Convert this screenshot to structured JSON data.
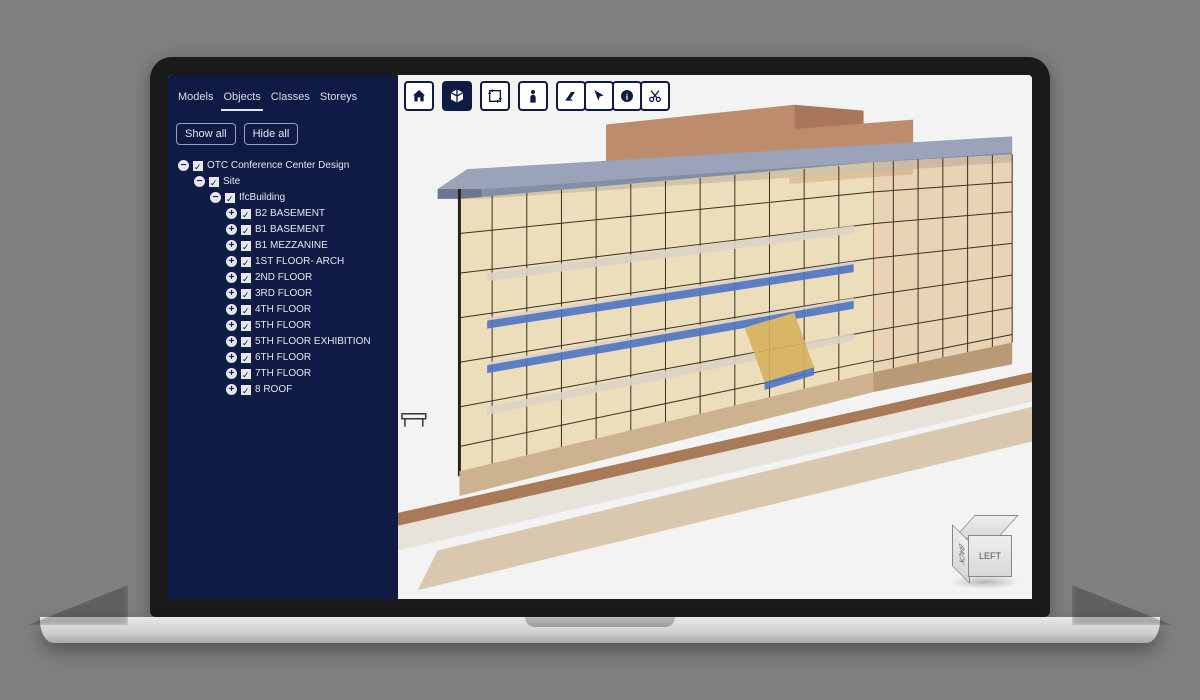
{
  "sidebar": {
    "tabs": [
      "Models",
      "Objects",
      "Classes",
      "Storeys"
    ],
    "active_tab": 1,
    "show_all": "Show all",
    "hide_all": "Hide all"
  },
  "tree": {
    "root": {
      "label": "OTC Conference Center Design",
      "expanded": true,
      "checked": true
    },
    "site": {
      "label": "Site",
      "expanded": true,
      "checked": true
    },
    "building": {
      "label": "IfcBuilding",
      "expanded": true,
      "checked": true
    },
    "storeys": [
      {
        "label": "B2 BASEMENT",
        "checked": true
      },
      {
        "label": "B1 BASEMENT",
        "checked": true
      },
      {
        "label": "B1 MEZZANINE",
        "checked": true
      },
      {
        "label": "1ST FLOOR- ARCH",
        "checked": true
      },
      {
        "label": "2ND FLOOR",
        "checked": true
      },
      {
        "label": "3RD FLOOR",
        "checked": true
      },
      {
        "label": "4TH FLOOR",
        "checked": true
      },
      {
        "label": "5TH FLOOR",
        "checked": true
      },
      {
        "label": "5TH FLOOR EXHIBITION",
        "checked": true
      },
      {
        "label": "6TH FLOOR",
        "checked": true
      },
      {
        "label": "7TH FLOOR",
        "checked": true
      },
      {
        "label": "8 ROOF",
        "checked": true
      }
    ]
  },
  "toolbar": [
    {
      "id": "home",
      "name": "home-icon",
      "active": false
    },
    {
      "id": "cube",
      "name": "cube-icon",
      "active": true
    },
    {
      "id": "crop",
      "name": "section-plane-icon",
      "active": false
    },
    {
      "id": "person",
      "name": "first-person-icon",
      "active": false
    },
    {
      "id": "eraser",
      "name": "hide-icon",
      "active": false
    },
    {
      "id": "pointer",
      "name": "select-icon",
      "active": false
    },
    {
      "id": "info",
      "name": "info-icon",
      "active": false
    },
    {
      "id": "scissors",
      "name": "cut-icon",
      "active": false
    }
  ],
  "navcube": {
    "front": "LEFT",
    "side": "BACK"
  },
  "colors": {
    "panel": "#0f1b45",
    "wall": "#b28264",
    "glass": "#ead6a8",
    "floor": "#d8cfc4",
    "accent": "#3f63b5"
  }
}
